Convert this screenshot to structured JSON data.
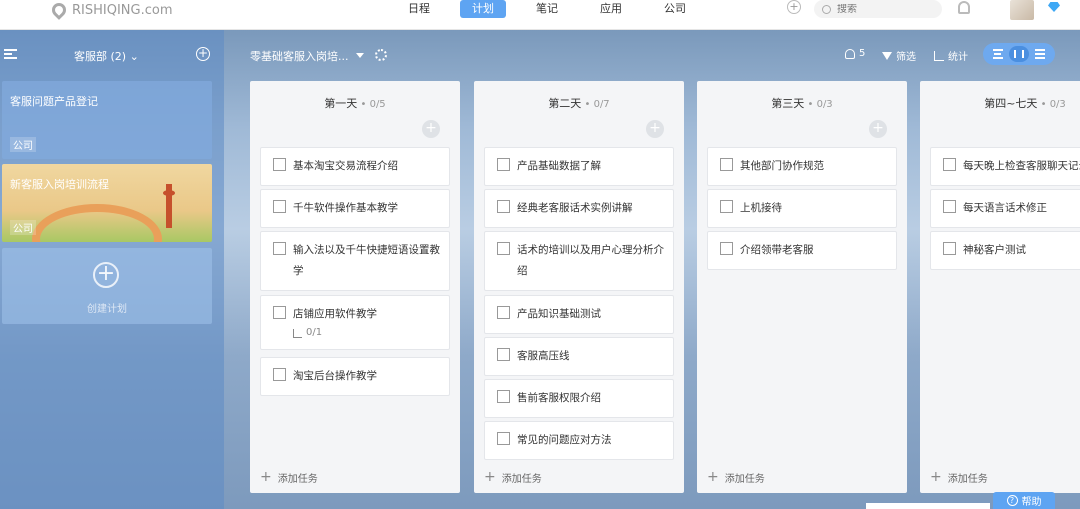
{
  "app": {
    "logo_text": "RISHIQING.com"
  },
  "nav": {
    "items": [
      "日程",
      "计划",
      "笔记",
      "应用",
      "公司"
    ],
    "active": "计划"
  },
  "search": {
    "placeholder": "搜索"
  },
  "sidebar": {
    "title": "客服部 (2)",
    "plans": [
      {
        "title": "客服问题产品登记",
        "tag": "公司"
      },
      {
        "title": "新客服入岗培训流程",
        "tag": "公司"
      }
    ],
    "create_label": "创建计划"
  },
  "board": {
    "title": "零基础客服入岗培...",
    "member_count": "5",
    "filter_label": "筛选",
    "stats_label": "统计",
    "add_task_label": "添加任务",
    "columns": [
      {
        "title": "第一天",
        "count": "0/5",
        "tasks": [
          {
            "text": "基本淘宝交易流程介绍"
          },
          {
            "text": "千牛软件操作基本教学"
          },
          {
            "text": "输入法以及千牛快捷短语设置教学"
          },
          {
            "text": "店铺应用软件教学",
            "sub": "0/1"
          },
          {
            "text": "淘宝后台操作教学"
          }
        ]
      },
      {
        "title": "第二天",
        "count": "0/7",
        "tasks": [
          {
            "text": "产品基础数据了解"
          },
          {
            "text": "经典老客服话术实例讲解"
          },
          {
            "text": "话术的培训以及用户心理分析介绍"
          },
          {
            "text": "产品知识基础测试"
          },
          {
            "text": "客服高压线"
          },
          {
            "text": "售前客服权限介绍"
          },
          {
            "text": "常见的问题应对方法"
          }
        ]
      },
      {
        "title": "第三天",
        "count": "0/3",
        "tasks": [
          {
            "text": "其他部门协作规范"
          },
          {
            "text": "上机接待"
          },
          {
            "text": "介绍领带老客服"
          }
        ]
      },
      {
        "title": "第四~七天",
        "count": "0/3",
        "tasks": [
          {
            "text": "每天晚上检查客服聊天记录"
          },
          {
            "text": "每天语言话术修正"
          },
          {
            "text": "神秘客户测试"
          }
        ]
      }
    ]
  },
  "help": {
    "label": "帮助"
  },
  "colors": {
    "accent": "#5ea4f2",
    "sidebar": "#5c8ac4",
    "column_bg": "#f4f5f7"
  },
  "icons": [
    "logo-pin-icon",
    "plus-circle-icon",
    "search-icon",
    "bell-icon",
    "gem-icon",
    "menu-icon",
    "gear-icon",
    "member-icon",
    "filter-icon",
    "stats-icon",
    "checkbox-icon",
    "subtask-icon",
    "help-icon"
  ]
}
